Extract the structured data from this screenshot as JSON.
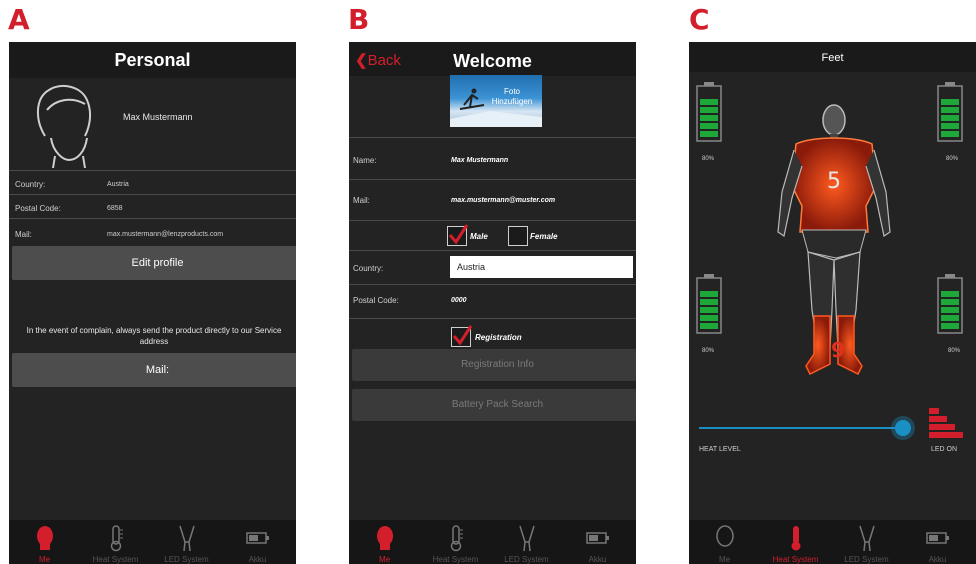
{
  "panels": [
    "A",
    "B",
    "C"
  ],
  "a": {
    "title": "Personal",
    "name": "Max Mustermann",
    "rows": [
      {
        "label": "Country:",
        "value": "Austria"
      },
      {
        "label": "Postal Code:",
        "value": "6858"
      },
      {
        "label": "Mail:",
        "value": "max.mustermann@lenzproducts.com"
      }
    ],
    "edit_button": "Edit profile",
    "notice": "In the event of complain, always send the product directly to our Service address",
    "mail_button": "Mail:"
  },
  "b": {
    "back": "Back",
    "title": "Welcome",
    "logo_text": "Foto Hinzufügen",
    "name_label": "Name:",
    "name_value": "Max Mustermann",
    "mail_label": "Mail:",
    "mail_value": "max.mustermann@muster.com",
    "male": "Male",
    "female": "Female",
    "country_label": "Country:",
    "country_value": "Austria",
    "postal_label": "Postal Code:",
    "postal_value": "0000",
    "registration": "Registration",
    "reg_info_button": "Registration Info",
    "battery_search_button": "Battery Pack Search"
  },
  "c": {
    "title": "Feet",
    "top_level": "5",
    "feet_level": "9",
    "battery_pct": {
      "tl": "80%",
      "tr": "80%",
      "bl": "80%",
      "br": "80%"
    },
    "battery_level": 0.8,
    "heat_label": "HEAT LEVEL",
    "led_label": "LED ON",
    "slider_value": 0.9
  },
  "tabs": [
    "Me",
    "Heat System",
    "LED System",
    "Akku"
  ],
  "colors": {
    "accent": "#d21f2b",
    "slider": "#1a8fc4",
    "battery": "#1fa83a"
  }
}
